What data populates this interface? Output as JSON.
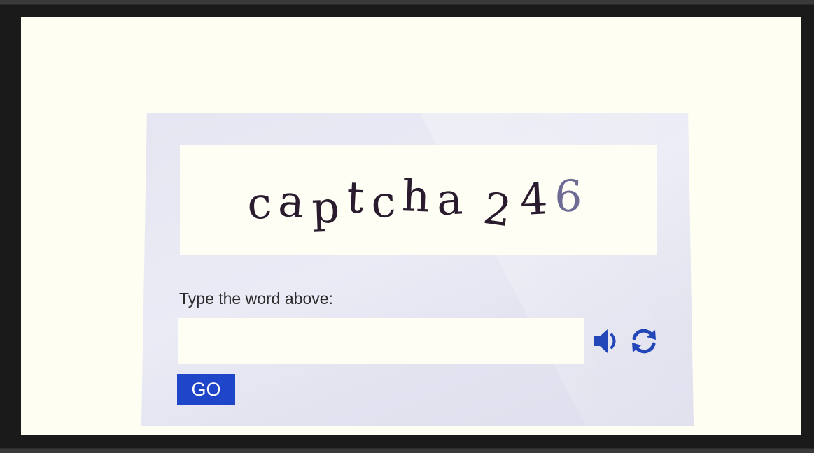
{
  "captcha": {
    "word": "captcha",
    "digits": [
      "2",
      "4",
      "6"
    ]
  },
  "form": {
    "prompt": "Type the word above:",
    "answer_value": "",
    "answer_placeholder": "",
    "submit_label": "GO"
  },
  "icons": {
    "audio": "speaker-icon",
    "refresh": "refresh-icon"
  },
  "colors": {
    "accent": "#1f46c8",
    "icon": "#2346b8",
    "captcha_text": "#2a1c2e",
    "captcha_faded_digit": "#6e6c95"
  }
}
